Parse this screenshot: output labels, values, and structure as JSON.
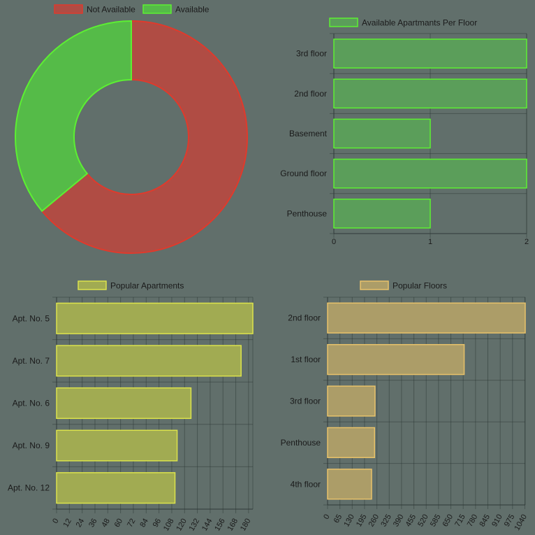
{
  "chart_data": [
    {
      "type": "pie",
      "variant": "doughnut",
      "title": "",
      "legend_position": "top",
      "labels": [
        "Not Available",
        "Available"
      ],
      "values": [
        64,
        36
      ],
      "colors": {
        "fill": [
          "#b04c44",
          "#55bb48"
        ],
        "stroke": [
          "#e03a2c",
          "#5cf032"
        ]
      }
    },
    {
      "type": "bar",
      "orientation": "horizontal",
      "title": "",
      "legend_position": "top",
      "series": [
        {
          "name": "Available Apartmants Per Floor",
          "values": [
            2,
            1,
            2,
            1,
            2
          ]
        }
      ],
      "categories": [
        "3rd floor",
        "2nd floor",
        "Basement",
        "Ground floor",
        "Penthouse"
      ],
      "values": [
        2,
        2,
        1,
        2,
        1
      ],
      "xlim": [
        0,
        2
      ],
      "ticks": [
        0,
        1,
        2
      ],
      "tick_rotation": 0,
      "grid": true,
      "colors": {
        "fill": "#5b9e5a",
        "stroke": "#5cf032"
      }
    },
    {
      "type": "bar",
      "orientation": "horizontal",
      "title": "",
      "legend_position": "top",
      "series": [
        {
          "name": "Popular Apartments"
        }
      ],
      "categories": [
        "Apt. No. 5",
        "Apt. No. 7",
        "Apt. No. 6",
        "Apt. No. 9",
        "Apt. No. 12"
      ],
      "values": [
        184,
        173,
        126,
        113,
        111
      ],
      "xlim": [
        0,
        184
      ],
      "ticks": [
        0,
        12,
        24,
        36,
        48,
        60,
        72,
        84,
        96,
        108,
        120,
        132,
        144,
        156,
        168,
        180
      ],
      "tick_rotation": -60,
      "grid": true,
      "colors": {
        "fill": "#a1ab52",
        "stroke": "#dce34c"
      }
    },
    {
      "type": "bar",
      "orientation": "horizontal",
      "title": "",
      "legend_position": "top",
      "series": [
        {
          "name": "Popular Floors"
        }
      ],
      "categories": [
        "2nd floor",
        "1st floor",
        "3rd floor",
        "Penthouse",
        "4th floor"
      ],
      "values": [
        1042,
        720,
        250,
        248,
        232
      ],
      "xlim": [
        0,
        1042
      ],
      "ticks": [
        0,
        65,
        130,
        195,
        260,
        325,
        390,
        455,
        520,
        585,
        650,
        715,
        780,
        845,
        910,
        975,
        1040
      ],
      "tick_rotation": -60,
      "grid": true,
      "colors": {
        "fill": "#ac9d68",
        "stroke": "#e8c26a"
      }
    }
  ]
}
